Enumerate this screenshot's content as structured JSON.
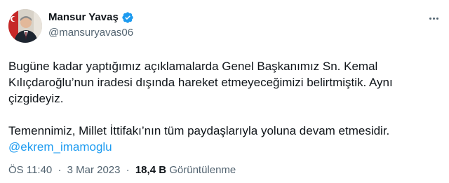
{
  "author": {
    "name": "Mansur Yavaş",
    "handle": "@mansuryavas06",
    "verified": true,
    "verified_color": "#1d9bf0"
  },
  "tweet": {
    "line1": "Bugüne kadar yaptığımız açıklamalarda Genel Başkanımız Sn. Kemal",
    "line2": "Kılıçdaroğlu’nun iradesi dışında hareket etmeyeceğimizi belirtmiştik. Aynı",
    "line3": "çizgideyiz.",
    "line4": "Temennimiz, Millet İttifakı’nın tüm paydaşlarıyla yoluna devam etmesidir.",
    "mention": "@ekrem_imamoglu"
  },
  "meta": {
    "time": "ÖS 11:40",
    "separator": "·",
    "date": "3 Mar 2023",
    "views_count": "18,4 B",
    "views_label": "Görüntülenme"
  },
  "icons": {
    "more": "more-options-icon",
    "verified": "verified-badge-icon"
  }
}
